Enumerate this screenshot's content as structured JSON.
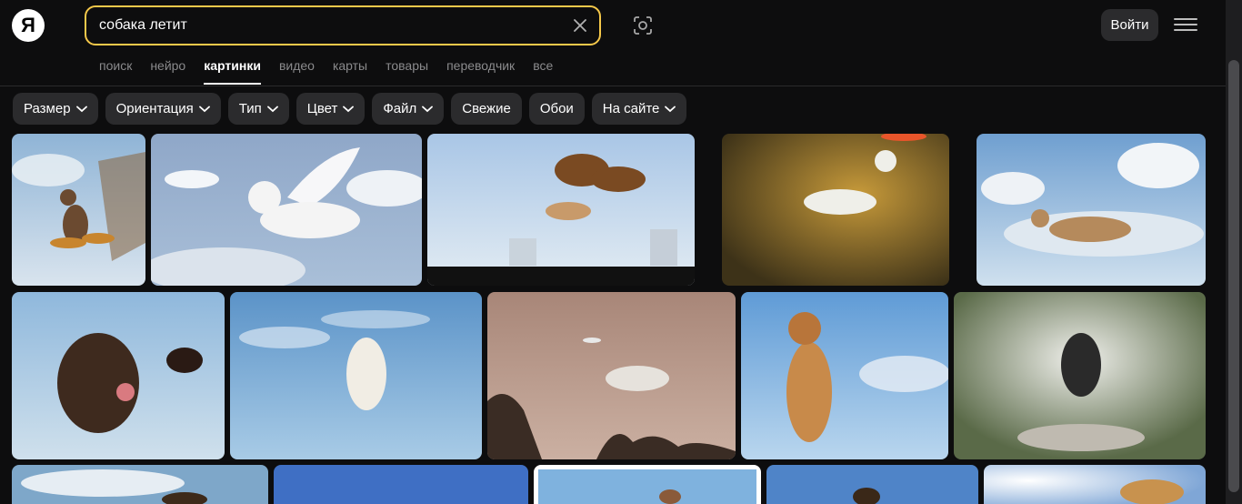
{
  "logo": {
    "letter": "Я"
  },
  "search": {
    "value": "собака летит",
    "placeholder": ""
  },
  "header": {
    "login_label": "Войти"
  },
  "tabs": [
    {
      "label": "поиск",
      "active": false
    },
    {
      "label": "нейро",
      "active": false
    },
    {
      "label": "картинки",
      "active": true
    },
    {
      "label": "видео",
      "active": false
    },
    {
      "label": "карты",
      "active": false
    },
    {
      "label": "товары",
      "active": false
    },
    {
      "label": "переводчик",
      "active": false
    },
    {
      "label": "все",
      "active": false
    }
  ],
  "filters": [
    {
      "label": "Размер",
      "dropdown": true
    },
    {
      "label": "Ориентация",
      "dropdown": true
    },
    {
      "label": "Тип",
      "dropdown": true
    },
    {
      "label": "Цвет",
      "dropdown": true
    },
    {
      "label": "Файл",
      "dropdown": true
    },
    {
      "label": "Свежие",
      "dropdown": false
    },
    {
      "label": "Обои",
      "dropdown": false
    },
    {
      "label": "На сайте",
      "dropdown": true
    }
  ],
  "colors": {
    "accent": "#f5c84a",
    "chip_bg": "#2b2b2d",
    "page_bg": "#0d0d0e"
  }
}
